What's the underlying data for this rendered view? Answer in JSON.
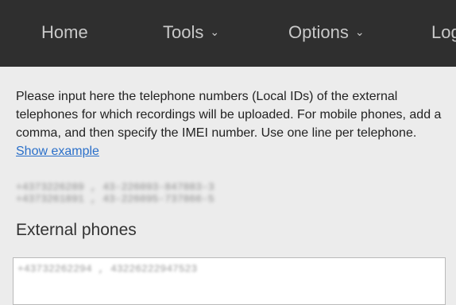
{
  "nav": {
    "items": [
      {
        "label": "Home"
      },
      {
        "label": "Tools",
        "caret": "⌄"
      },
      {
        "label": "Options",
        "caret": "⌄"
      },
      {
        "label": "Log"
      }
    ]
  },
  "main": {
    "instructions": "Please input here the telephone numbers (Local IDs) of the external telephones for which recordings will be uploaded. For mobile phones, add a comma, and then specify the IMEI number. Use one line per telephone.",
    "show_example_link": "Show example",
    "example_lines": [
      "+4373226289 , 43-226093-847883-3",
      "+4373261891 , 43-226095-737866-5"
    ],
    "section_title": "External phones",
    "phones_input_value": "+43732262294 , 43226222947523"
  },
  "colors": {
    "topbar": "#2f2f2f",
    "link": "#2a6fc9",
    "background": "#ececec"
  }
}
